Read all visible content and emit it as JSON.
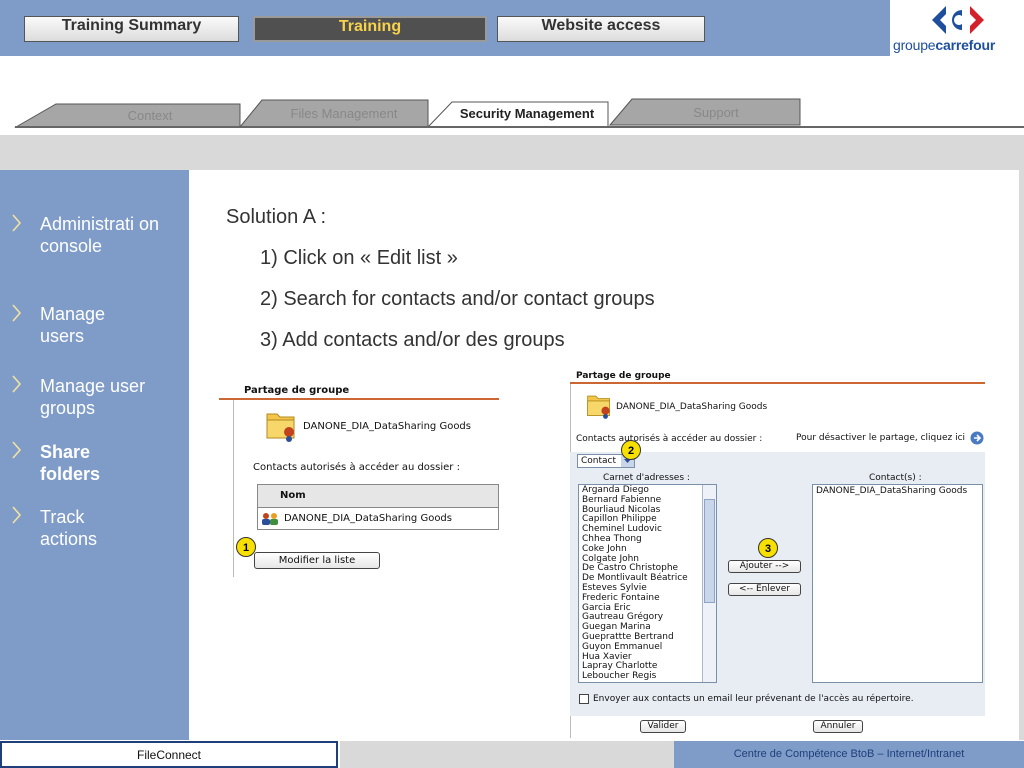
{
  "header": {
    "tabs": [
      {
        "label": "Training Summary",
        "active": false
      },
      {
        "label": "Training",
        "active": true
      },
      {
        "label": "Website access",
        "active": false
      }
    ],
    "logo": {
      "word1": "groupe",
      "word2": "carrefour"
    }
  },
  "subtabs": [
    {
      "label": "Context",
      "active": false
    },
    {
      "label": "Files Management",
      "active": false
    },
    {
      "label": "Security Management",
      "active": true
    },
    {
      "label": "Support",
      "active": false
    }
  ],
  "sidebar": {
    "items": [
      {
        "label": "Administrati on console",
        "active": false
      },
      {
        "label": "Manage users",
        "active": false
      },
      {
        "label": "Manage user groups",
        "active": false
      },
      {
        "label": "Share folders",
        "active": true
      },
      {
        "label": "Track actions",
        "active": false
      }
    ]
  },
  "content": {
    "solution": "Solution A :",
    "steps": [
      "1) Click on « Edit list »",
      "2) Search for contacts and/or contact groups",
      "3) Add contacts and/or des groups"
    ]
  },
  "shot1": {
    "title": "Partage de groupe",
    "folder": "DANONE_DIA_DataSharing Goods",
    "contacts_label": "Contacts autorisés à accéder au dossier :",
    "column": "Nom",
    "row": "DANONE_DIA_DataSharing Goods",
    "button": "Modifier la liste",
    "badge": "1"
  },
  "shot2": {
    "title": "Partage de groupe",
    "folder": "DANONE_DIA_DataSharing Goods",
    "contacts_label": "Contacts autorisés à accéder au dossier :",
    "disable_label": "Pour désactiver le partage, cliquez ici",
    "select_value": "Contact",
    "address_book_label": "Carnet d'adresses :",
    "contacts_col_label": "Contact(s) :",
    "address_book": [
      "Arganda Diego",
      "Bernard Fabienne",
      "Bourliaud Nicolas",
      "Capillon Philippe",
      "Cheminel Ludovic",
      "Chhea Thong",
      "Coke John",
      "Colgate John",
      "De Castro Christophe",
      "De Montlivault Béatrice",
      "Esteves Sylvie",
      "Frederic Fontaine",
      "Garcia Eric",
      "Gautreau Grégory",
      "Guegan Marina",
      "Gueprattte Bertrand",
      "Guyon Emmanuel",
      "Hua Xavier",
      "Lapray Charlotte",
      "Leboucher Regis"
    ],
    "selected_contacts": [
      "DANONE_DIA_DataSharing Goods"
    ],
    "add_button": "Ajouter -->",
    "remove_button": "<-- Enlever",
    "email_checkbox": "Envoyer aux contacts un email leur prévenant de l'accès au répertoire.",
    "ok_button": "Valider",
    "cancel_button": "Annuler",
    "badge2": "2",
    "badge3": "3"
  },
  "footer": {
    "left": "FileConnect",
    "right": "Centre de Compétence BtoB – Internet/Intranet"
  },
  "colors": {
    "brand_blue": "#7f9cc9",
    "active_tab_text": "#f7d24a",
    "badge_yellow": "#f7e000",
    "panel_rule": "#cc6633"
  }
}
